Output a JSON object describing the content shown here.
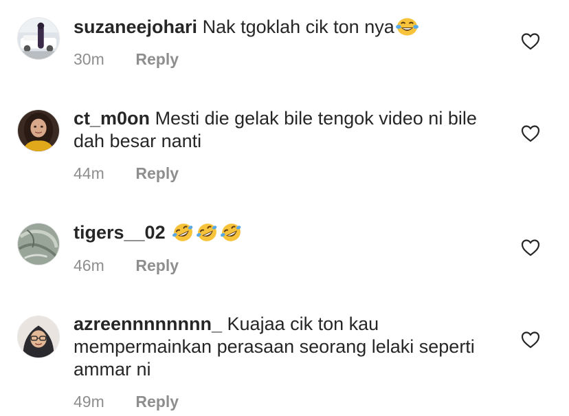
{
  "comments": [
    {
      "username": "suzaneejohari",
      "text": "Nak tgoklah cik ton nya",
      "emojis": [
        "joy"
      ],
      "time": "30m",
      "reply_label": "Reply"
    },
    {
      "username": "ct_m0on",
      "text": "Mesti die gelak bile tengok video ni bile dah besar nanti",
      "emojis": [],
      "time": "44m",
      "reply_label": "Reply"
    },
    {
      "username": "tigers__02",
      "text": "",
      "emojis": [
        "rofl",
        "rofl",
        "rofl"
      ],
      "time": "46m",
      "reply_label": "Reply"
    },
    {
      "username": "azreennnnnnnn_",
      "text": "Kuajaa cik ton kau mempermainkan perasaan seorang lelaki seperti ammar ni",
      "emojis": [],
      "time": "49m",
      "reply_label": "Reply"
    }
  ],
  "icons": {
    "like": "heart-outline-icon",
    "joy": "face-with-tears-of-joy-emoji",
    "rofl": "rolling-on-floor-laughing-emoji"
  },
  "colors": {
    "text": "#262626",
    "muted": "#8e8e8e",
    "emoji_yellow": "#f7c33a",
    "tear_blue": "#5aa9e6"
  }
}
